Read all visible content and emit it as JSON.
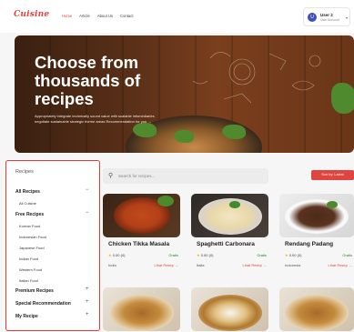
{
  "app": {
    "logo": "Cuisine"
  },
  "nav": {
    "items": [
      "Home",
      "Article",
      "About Us",
      "Contact"
    ],
    "active": "Home"
  },
  "user": {
    "initial": "U",
    "name": "User 2",
    "role": "User Account",
    "caret": "▾"
  },
  "hero": {
    "title": "Choose from thousands of recipes",
    "subtitle": "Appropriately integrate technically sound value with scalable infomediaries negotiate sustainable strategic theme areas Recommendation for you →"
  },
  "sidebar": {
    "title": "Recipes",
    "all_recipes": "All Recipes",
    "all_cuisine": "All Cuisine",
    "free_recipes": "Free Recipes",
    "free_items": [
      "Korean Food",
      "Indonesian Food",
      "Japanese Food",
      "Indian Food",
      "Western Food",
      "Italian Food"
    ],
    "premium": "Premium Recipes",
    "special": "Special Recommendation",
    "my_recipe": "My Recipe",
    "minus": "−",
    "plus": "+"
  },
  "search": {
    "placeholder": "Search for recipes...",
    "icon": "search-icon"
  },
  "sort": {
    "label": "Sort by: Latest"
  },
  "recipes": [
    {
      "name": "Chicken Tikka Masala",
      "rating": "0.00 (0)",
      "price": "Gratis",
      "origin": "India",
      "link": "Lihat Resep →"
    },
    {
      "name": "Spaghetti Carbonara",
      "rating": "0.00 (0)",
      "price": "Gratis",
      "origin": "Italia",
      "link": "Lihat Resep →"
    },
    {
      "name": "Rendang Padang",
      "rating": "0.00 (0)",
      "price": "Gratis",
      "origin": "Indonesia",
      "link": "Lihat Resep →"
    }
  ],
  "colors": {
    "accent": "#e0443f",
    "price": "#2e7d32",
    "star": "#f0b400"
  }
}
